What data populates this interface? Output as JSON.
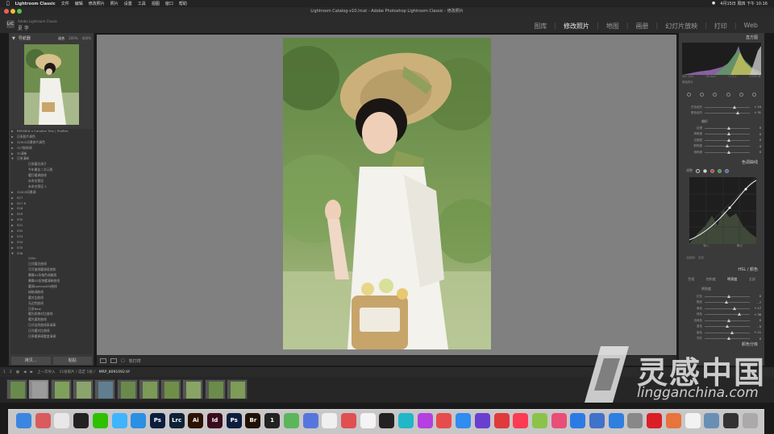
{
  "menubar": {
    "app_name": "Lightroom Classic",
    "items": [
      "文件",
      "编辑",
      "修改照片",
      "照片",
      "设置",
      "工具",
      "视图",
      "窗口",
      "帮助"
    ],
    "status_right": "4月15日 周四 下午 10:16"
  },
  "window": {
    "title": "Lightroom Catalog-v10.lrcat - Adobe Photoshop Lightroom Classic - 修改照片"
  },
  "identity": {
    "logo": "LrC",
    "catalog_caption": "Adobe Lightroom Classic",
    "user": "夏 李"
  },
  "modules": [
    "图库",
    "修改照片",
    "地图",
    "画册",
    "幻灯片放映",
    "打印",
    "Web"
  ],
  "active_module": "修改照片",
  "navigator": {
    "title": "导航器",
    "zoom_options": [
      "适合",
      "100%",
      "400%"
    ],
    "zoom_active": "适合"
  },
  "presets": [
    {
      "label": "REFINED x Caroline Tran | Profiles",
      "level": 0
    },
    {
      "label": "日系胶片调色",
      "level": 0
    },
    {
      "label": "32001风景修片调色",
      "level": 0
    },
    {
      "label": "31T胶修调",
      "level": 0
    },
    {
      "label": "32清新",
      "level": 0
    },
    {
      "label": "日系清新",
      "level": 0,
      "open": true
    },
    {
      "label": "日系暖光调子",
      "level": 1
    },
    {
      "label": "今年最佳二次元照",
      "level": 1
    },
    {
      "label": "暖灯暖调曲线",
      "level": 1
    },
    {
      "label": "未命名预设",
      "level": 1
    },
    {
      "label": "未命名预设 2",
      "level": 1
    },
    {
      "label": "32003风景调",
      "level": 0
    },
    {
      "label": "S27",
      "level": 0
    },
    {
      "label": "S27 B",
      "level": 0
    },
    {
      "label": "S28",
      "level": 0
    },
    {
      "label": "S29",
      "level": 0
    },
    {
      "label": "S30",
      "level": 0
    },
    {
      "label": "S31",
      "level": 0
    },
    {
      "label": "S32",
      "level": 0
    },
    {
      "label": "S33",
      "level": 0
    },
    {
      "label": "S34",
      "level": 0
    },
    {
      "label": "S35",
      "level": 0
    },
    {
      "label": "S36",
      "level": 0,
      "open": true
    },
    {
      "label": "240n",
      "level": 1
    },
    {
      "label": "日式暖光曲线",
      "level": 1
    },
    {
      "label": "可可曲线暖调低饱和",
      "level": 1
    },
    {
      "label": "暴躁01风格色调曲线",
      "level": 1
    },
    {
      "label": "暴躁02低饱暖清新曲线",
      "level": 1
    },
    {
      "label": "暖调contrast09曲线",
      "level": 1
    },
    {
      "label": "绿暗调曲线",
      "level": 1
    },
    {
      "label": "暖对比曲线",
      "level": 1
    },
    {
      "label": "无边色曲线",
      "level": 1
    },
    {
      "label": "日系New",
      "level": 1
    },
    {
      "label": "暖光质感对比曲线",
      "level": 1
    },
    {
      "label": "暖光柔和曲线",
      "level": 1
    },
    {
      "label": "日式自然曲线高调青",
      "level": 1
    },
    {
      "label": "日光暖对比曲线",
      "level": 1
    },
    {
      "label": "日系暖调调整变清调",
      "level": 1
    }
  ],
  "left_buttons": {
    "copy": "拷贝...",
    "paste": "粘贴"
  },
  "toolbar": {
    "label": "软打样"
  },
  "right_panel": {
    "histogram_title": "直方图",
    "histo_info": [
      "ISO 100",
      "50 mm",
      "f / 2.2",
      "1/250 秒"
    ],
    "original_photo": "原始照片",
    "sliders_top": [
      {
        "label": "白色色阶",
        "value": "+ 15"
      },
      {
        "label": "黑色色阶",
        "value": "+ 31"
      }
    ],
    "presence_title": "偏好",
    "sliders_presence": [
      {
        "label": "纹理",
        "value": "0",
        "pos": 0.5
      },
      {
        "label": "清晰度",
        "value": "0",
        "pos": 0.5
      },
      {
        "label": "去朦胧",
        "value": "0",
        "pos": 0.5
      },
      {
        "label": "鲜艳度",
        "value": "- 4",
        "pos": 0.46
      },
      {
        "label": "饱和度",
        "value": "0",
        "pos": 0.5
      }
    ],
    "tone_curve_title": "色调曲线",
    "curve_adjust": "调整",
    "curve_info": [
      "输入",
      "输出"
    ],
    "point_curve_label": "点曲线：",
    "point_curve_value": "自定",
    "hsl_title": "HSL / 颜色",
    "hsl_tabs": [
      "色相",
      "饱和度",
      "明亮度",
      "全部"
    ],
    "hsl_active": "明亮度",
    "hsl_sub": "明亮度",
    "hsl_sliders": [
      {
        "label": "红色",
        "value": "0",
        "pos": 0.5
      },
      {
        "label": "橙色",
        "value": "- 7",
        "pos": 0.44
      },
      {
        "label": "黄色",
        "value": "+ 17",
        "pos": 0.62
      },
      {
        "label": "绿色",
        "value": "+ 36",
        "pos": 0.74
      },
      {
        "label": "浅绿色",
        "value": "0",
        "pos": 0.5
      },
      {
        "label": "蓝色",
        "value": "- 5",
        "pos": 0.46
      },
      {
        "label": "紫色",
        "value": "+ 11",
        "pos": 0.58
      },
      {
        "label": "洋红",
        "value": "0",
        "pos": 0.5
      }
    ],
    "color_grading_title": "颜色分级"
  },
  "filmstrip": {
    "pages": [
      "1",
      "2"
    ],
    "nav_label": "上一次导入",
    "count": "11张照片 / 选定 1张 /",
    "filename": "MRP_8091092.tif",
    "thumb_count": 11,
    "selected_index": 1
  },
  "watermark": {
    "title": "灵感中国",
    "subtitle": "lingganchina.com"
  },
  "dock": [
    {
      "name": "finder",
      "label": "",
      "color": "#3b86e0"
    },
    {
      "name": "launchpad",
      "label": "",
      "color": "#d95b5b"
    },
    {
      "name": "chrome",
      "label": "",
      "color": "#e8e8e8"
    },
    {
      "name": "qq",
      "label": "",
      "color": "#222"
    },
    {
      "name": "wechat",
      "label": "",
      "color": "#2dc100"
    },
    {
      "name": "messages",
      "label": "",
      "color": "#3fb4ff"
    },
    {
      "name": "safari",
      "label": "",
      "color": "#2b8fe3"
    },
    {
      "name": "photoshop",
      "label": "Ps",
      "color": "#0b1e3d"
    },
    {
      "name": "lightroom-classic",
      "label": "Lrc",
      "color": "#0e2236"
    },
    {
      "name": "illustrator",
      "label": "Ai",
      "color": "#2c1300"
    },
    {
      "name": "indesign",
      "label": "Id",
      "color": "#3a0b1e"
    },
    {
      "name": "photoshop-2",
      "label": "Ps",
      "color": "#0b1e3d"
    },
    {
      "name": "bridge",
      "label": "Br",
      "color": "#201202"
    },
    {
      "name": "app-1",
      "label": "1",
      "color": "#222"
    },
    {
      "name": "maps",
      "label": "",
      "color": "#5bb65b"
    },
    {
      "name": "app-circles",
      "label": "",
      "color": "#5577dd"
    },
    {
      "name": "photos",
      "label": "",
      "color": "#f0f0f0"
    },
    {
      "name": "app-grid",
      "label": "",
      "color": "#e05050"
    },
    {
      "name": "app-pen",
      "label": "",
      "color": "#f4f4f4"
    },
    {
      "name": "final-cut",
      "label": "",
      "color": "#222"
    },
    {
      "name": "app-u",
      "label": "",
      "color": "#21b6c8"
    },
    {
      "name": "podcasts",
      "label": "",
      "color": "#b53fe0"
    },
    {
      "name": "app-red",
      "label": "",
      "color": "#e64c4c"
    },
    {
      "name": "app-store",
      "label": "",
      "color": "#2f8cf0"
    },
    {
      "name": "app-purple",
      "label": "",
      "color": "#6a3fd0"
    },
    {
      "name": "app-power",
      "label": "",
      "color": "#e03a3a"
    },
    {
      "name": "music",
      "label": "",
      "color": "#fc3c52"
    },
    {
      "name": "app-green",
      "label": "",
      "color": "#8bc34a"
    },
    {
      "name": "app-pink",
      "label": "",
      "color": "#e94e77"
    },
    {
      "name": "app-x",
      "label": "",
      "color": "#2c7be5"
    },
    {
      "name": "app-w",
      "label": "",
      "color": "#3f72c8"
    },
    {
      "name": "app-bird",
      "label": "",
      "color": "#2f7fe0"
    },
    {
      "name": "system-preferences",
      "label": "",
      "color": "#888"
    },
    {
      "name": "creative-cloud",
      "label": "",
      "color": "#da1f26"
    },
    {
      "name": "app-stripes",
      "label": "",
      "color": "#e8733b"
    },
    {
      "name": "textedit",
      "label": "",
      "color": "#f2f2f2"
    },
    {
      "name": "preview",
      "label": "",
      "color": "#6a8fb5"
    },
    {
      "name": "app-dark",
      "label": "",
      "color": "#333"
    },
    {
      "name": "trash",
      "label": "",
      "color": "#aaa"
    }
  ]
}
